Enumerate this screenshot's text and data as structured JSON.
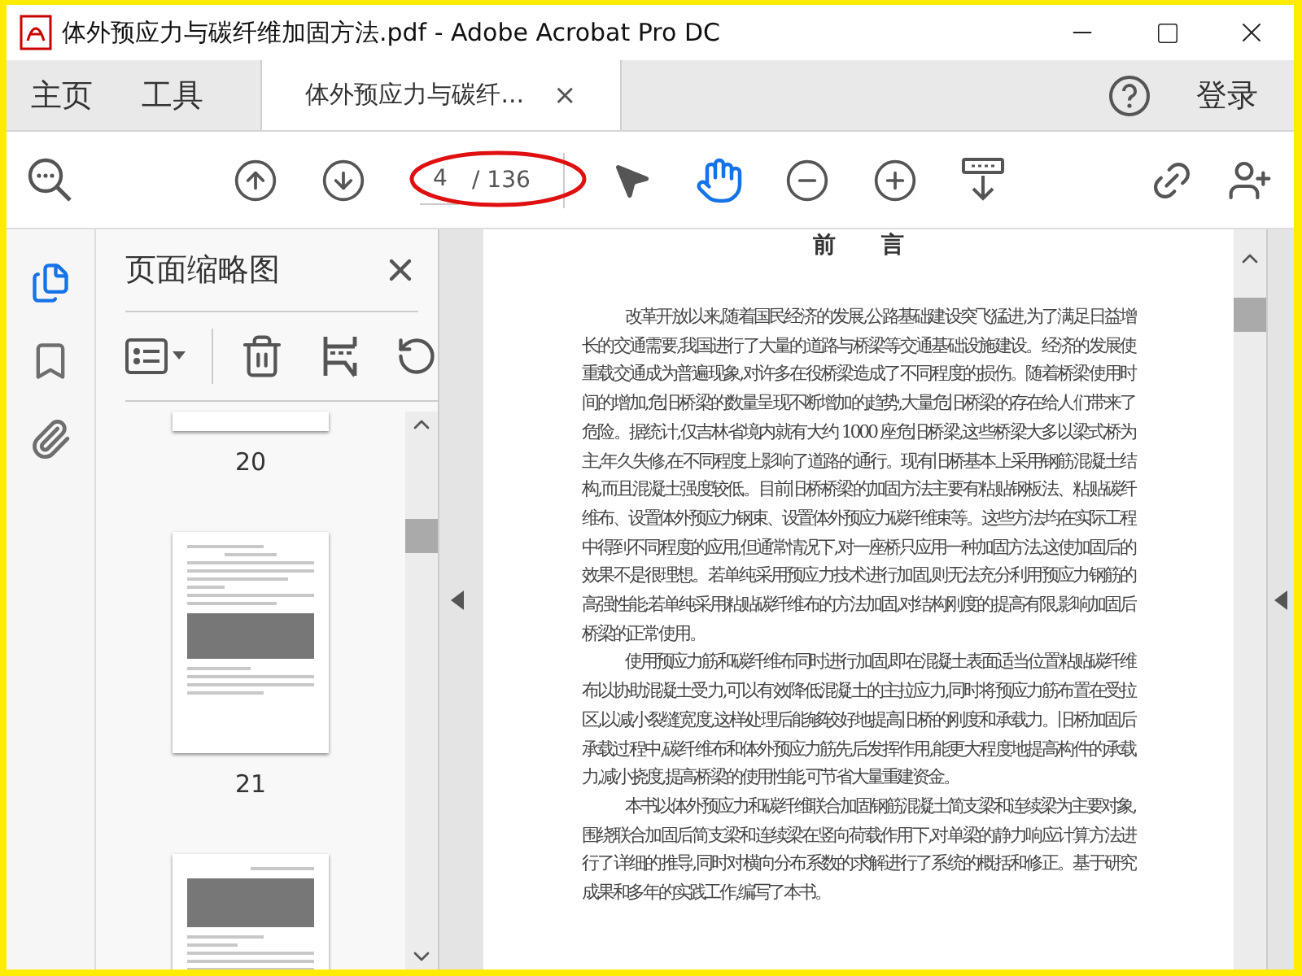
{
  "window": {
    "title": "体外预应力与碳纤维加固方法.pdf - Adobe Acrobat Pro DC"
  },
  "tabs": [
    {
      "label": "主页",
      "kind": "nav",
      "selected": false
    },
    {
      "label": "工具",
      "kind": "nav",
      "selected": false
    },
    {
      "label": "体外预应力与碳纤...",
      "kind": "document",
      "selected": true,
      "close": "×"
    }
  ],
  "account": {
    "label": "登录"
  },
  "toolbar": {
    "tools": [
      {
        "kind": "select",
        "selected": false
      },
      {
        "kind": "hand",
        "selected": true
      }
    ],
    "page_field": {
      "value": "4",
      "total": "/ 136"
    }
  },
  "rail": [
    {
      "kind": "pages",
      "selected": true
    },
    {
      "kind": "bookmarks",
      "selected": false
    },
    {
      "kind": "attachments",
      "selected": false
    }
  ],
  "thumbnails_panel": {
    "title": "页面缩略图",
    "thumbnails": [
      {
        "label": "20",
        "kind": "tail"
      },
      {
        "label": "21",
        "kind": "page"
      }
    ]
  },
  "document": {
    "heading": "前　　言",
    "paragraphs": [
      "改革开放以来,随着国民经济的发展,公路基础建设突飞猛进,为了满足日益增长的交通需要,我国进行了大量的道路与桥梁等交通基础设施建设。经济的发展使重载交通成为普遍现象,对许多在役桥梁造成了不同程度的损伤。随着桥梁使用时间的增加,危旧桥梁的数量呈现不断增加的趋势,大量危旧桥梁的存在给人们带来了危险。据统计,仅吉林省境内就有大约 1000 座危旧桥梁,这些桥梁大多以梁式桥为主,年久失修,在不同程度上影响了道路的通行。现有旧桥基本上采用钢筋混凝土结构,而且混凝土强度较低。目前旧桥桥梁的加固方法主要有粘贴钢板法、粘贴碳纤维布、设置体外预应力钢束、设置体外预应力碳纤维束等。这些方法均在实际工程中得到不同程度的应用,但通常情况下,对一座桥只应用一种加固方法,这使加固后的效果不是很理想。若单纯采用预应力技术进行加固,则无法充分利用预应力钢筋的高强性能;若单纯采用粘贴碳纤维布的方法加固,对结构刚度的提高有限,影响加固后桥梁的正常使用。",
      "使用预应力筋和碳纤维布同时进行加固,即在混凝土表面适当位置粘贴碳纤维布以协助混凝土受力,可以有效降低混凝土的主拉应力,同时将预应力筋布置在受拉区,以减小裂缝宽度,这样处理后能够较好地提高旧桥的刚度和承载力。旧桥加固后承载过程中,碳纤维布和体外预应力筋先后发挥作用,能更大程度地提高构件的承载力,减小挠度,提高桥梁的使用性能,可节省大量重建资金。",
      "本书以体外预应力和碳纤维联合加固钢筋混凝土简支梁和连续梁为主要对象,围绕联合加固后简支梁和连续梁在竖向荷载作用下,对单梁的静力响应计算方法进行了详细的推导,同时对横向分布系数的求解进行了系统的概括和修正。基于研究成果和多年的实践工作,编写了本书。"
    ]
  }
}
